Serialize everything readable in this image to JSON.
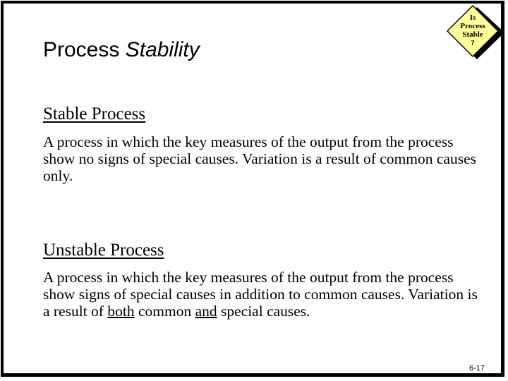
{
  "slide": {
    "title_plain": "Process ",
    "title_italic": "Stability",
    "badge": {
      "lines": [
        "Is",
        "Process",
        "Stable",
        "?"
      ],
      "fill_color": "#ffff99",
      "shadow_color": "#000000"
    },
    "sections": [
      {
        "heading": "Stable Process",
        "body": "A process in which the key measures of the output from the process show no signs of special causes.  Variation is a result of common causes only."
      },
      {
        "heading": "Unstable Process",
        "body_part1": "A process in which the key measures of the output from the process show signs of special causes in addition to common causes.  Variation is a result of ",
        "emph1": "both",
        "body_part2": " common ",
        "emph2": "and",
        "body_part3": " special causes."
      }
    ],
    "page_number": "6-17"
  }
}
